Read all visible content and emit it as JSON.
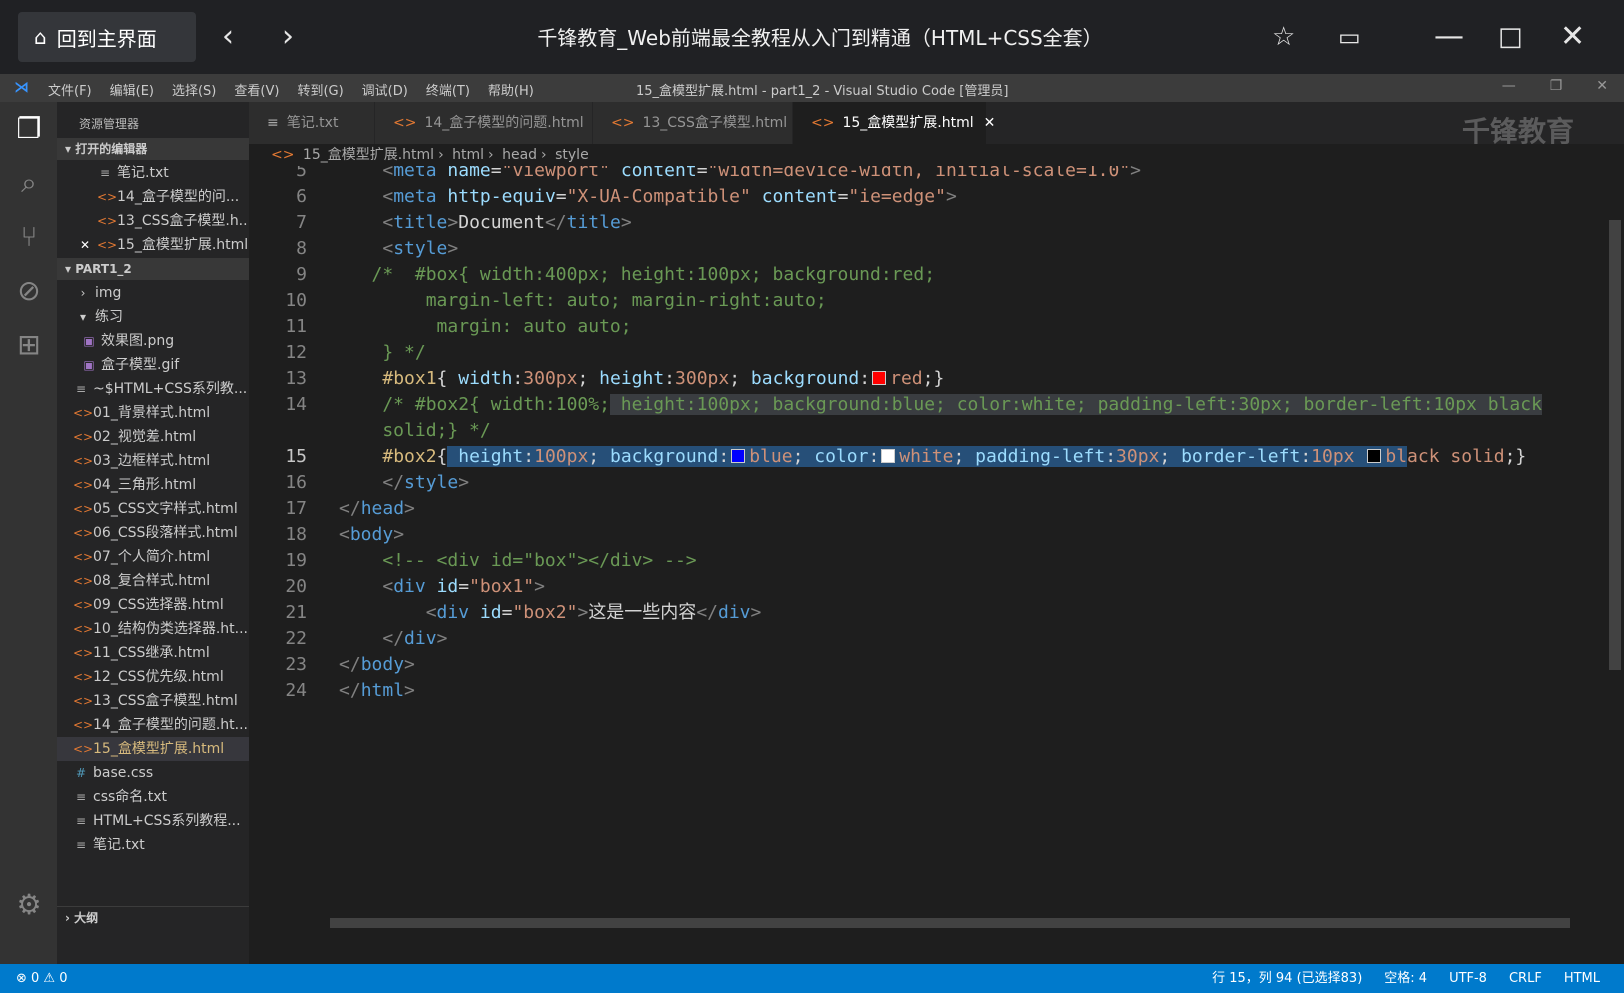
{
  "player": {
    "home_label": "回到主界面",
    "title": "千锋教育_Web前端最全教程从入门到精通（HTML+CSS全套）",
    "icons": [
      "house-icon",
      "chevron-left-icon",
      "chevron-right-icon",
      "pin-icon",
      "picture-in-picture-icon",
      "minimize-icon",
      "maximize-icon",
      "close-icon"
    ]
  },
  "vscode": {
    "menu": [
      "文件(F)",
      "编辑(E)",
      "选择(S)",
      "查看(V)",
      "转到(G)",
      "调试(D)",
      "终端(T)",
      "帮助(H)"
    ],
    "window_caption": "15_盒模型扩展.html - part1_2 - Visual Studio Code [管理员]"
  },
  "sidebar": {
    "title": "资源管理器",
    "open_editors_label": "打开的编辑器",
    "open_editors": [
      "笔记.txt",
      "14_盒子模型的问...",
      "13_CSS盒子模型.h...",
      "15_盒模型扩展.html"
    ],
    "folder_label": "PART1_2",
    "tree": [
      {
        "label": "img",
        "type": "folder"
      },
      {
        "label": "练习",
        "type": "folder-open"
      },
      {
        "label": "效果图.png",
        "type": "image"
      },
      {
        "label": "盒子模型.gif",
        "type": "image"
      },
      {
        "label": "~$HTML+CSS系列教...",
        "type": "text"
      },
      {
        "label": "01_背景样式.html",
        "type": "html"
      },
      {
        "label": "02_视觉差.html",
        "type": "html"
      },
      {
        "label": "03_边框样式.html",
        "type": "html"
      },
      {
        "label": "04_三角形.html",
        "type": "html"
      },
      {
        "label": "05_CSS文字样式.html",
        "type": "html"
      },
      {
        "label": "06_CSS段落样式.html",
        "type": "html"
      },
      {
        "label": "07_个人简介.html",
        "type": "html"
      },
      {
        "label": "08_复合样式.html",
        "type": "html"
      },
      {
        "label": "09_CSS选择器.html",
        "type": "html"
      },
      {
        "label": "10_结构伪类选择器.ht...",
        "type": "html"
      },
      {
        "label": "11_CSS继承.html",
        "type": "html"
      },
      {
        "label": "12_CSS优先级.html",
        "type": "html"
      },
      {
        "label": "13_CSS盒子模型.html",
        "type": "html"
      },
      {
        "label": "14_盒子模型的问题.ht...",
        "type": "html"
      },
      {
        "label": "15_盒模型扩展.html",
        "type": "html"
      },
      {
        "label": "base.css",
        "type": "css"
      },
      {
        "label": "css命名.txt",
        "type": "text"
      },
      {
        "label": "HTML+CSS系列教程...",
        "type": "text"
      },
      {
        "label": "笔记.txt",
        "type": "text"
      }
    ],
    "outline_label": "大纲"
  },
  "tabs": [
    {
      "label": "笔记.txt"
    },
    {
      "label": "14_盒子模型的问题.html"
    },
    {
      "label": "13_CSS盒子模型.html"
    },
    {
      "label": "15_盒模型扩展.html",
      "active": true
    }
  ],
  "watermark": "千锋教育",
  "breadcrumb": [
    "15_盒模型扩展.html",
    "html",
    "head",
    "style"
  ],
  "editor": {
    "line_numbers": [
      "5",
      "6",
      "7",
      "8",
      "9",
      "10",
      "11",
      "12",
      "13",
      "14",
      "",
      "15",
      "16",
      "17",
      "18",
      "19",
      "20",
      "21",
      "22",
      "23",
      "24"
    ],
    "current_line": "15",
    "swatch_colors": {
      "red": "#ff0000",
      "blue": "#0000ff",
      "white": "#ffffff",
      "black": "#000000"
    }
  },
  "statusbar": {
    "problems": "⊗ 0 ⚠ 0",
    "position": "行 15，列 94 (已选择83)",
    "spaces": "空格: 4",
    "encoding": "UTF-8",
    "eol": "CRLF",
    "language": "HTML"
  },
  "accent_color": "#007acc"
}
